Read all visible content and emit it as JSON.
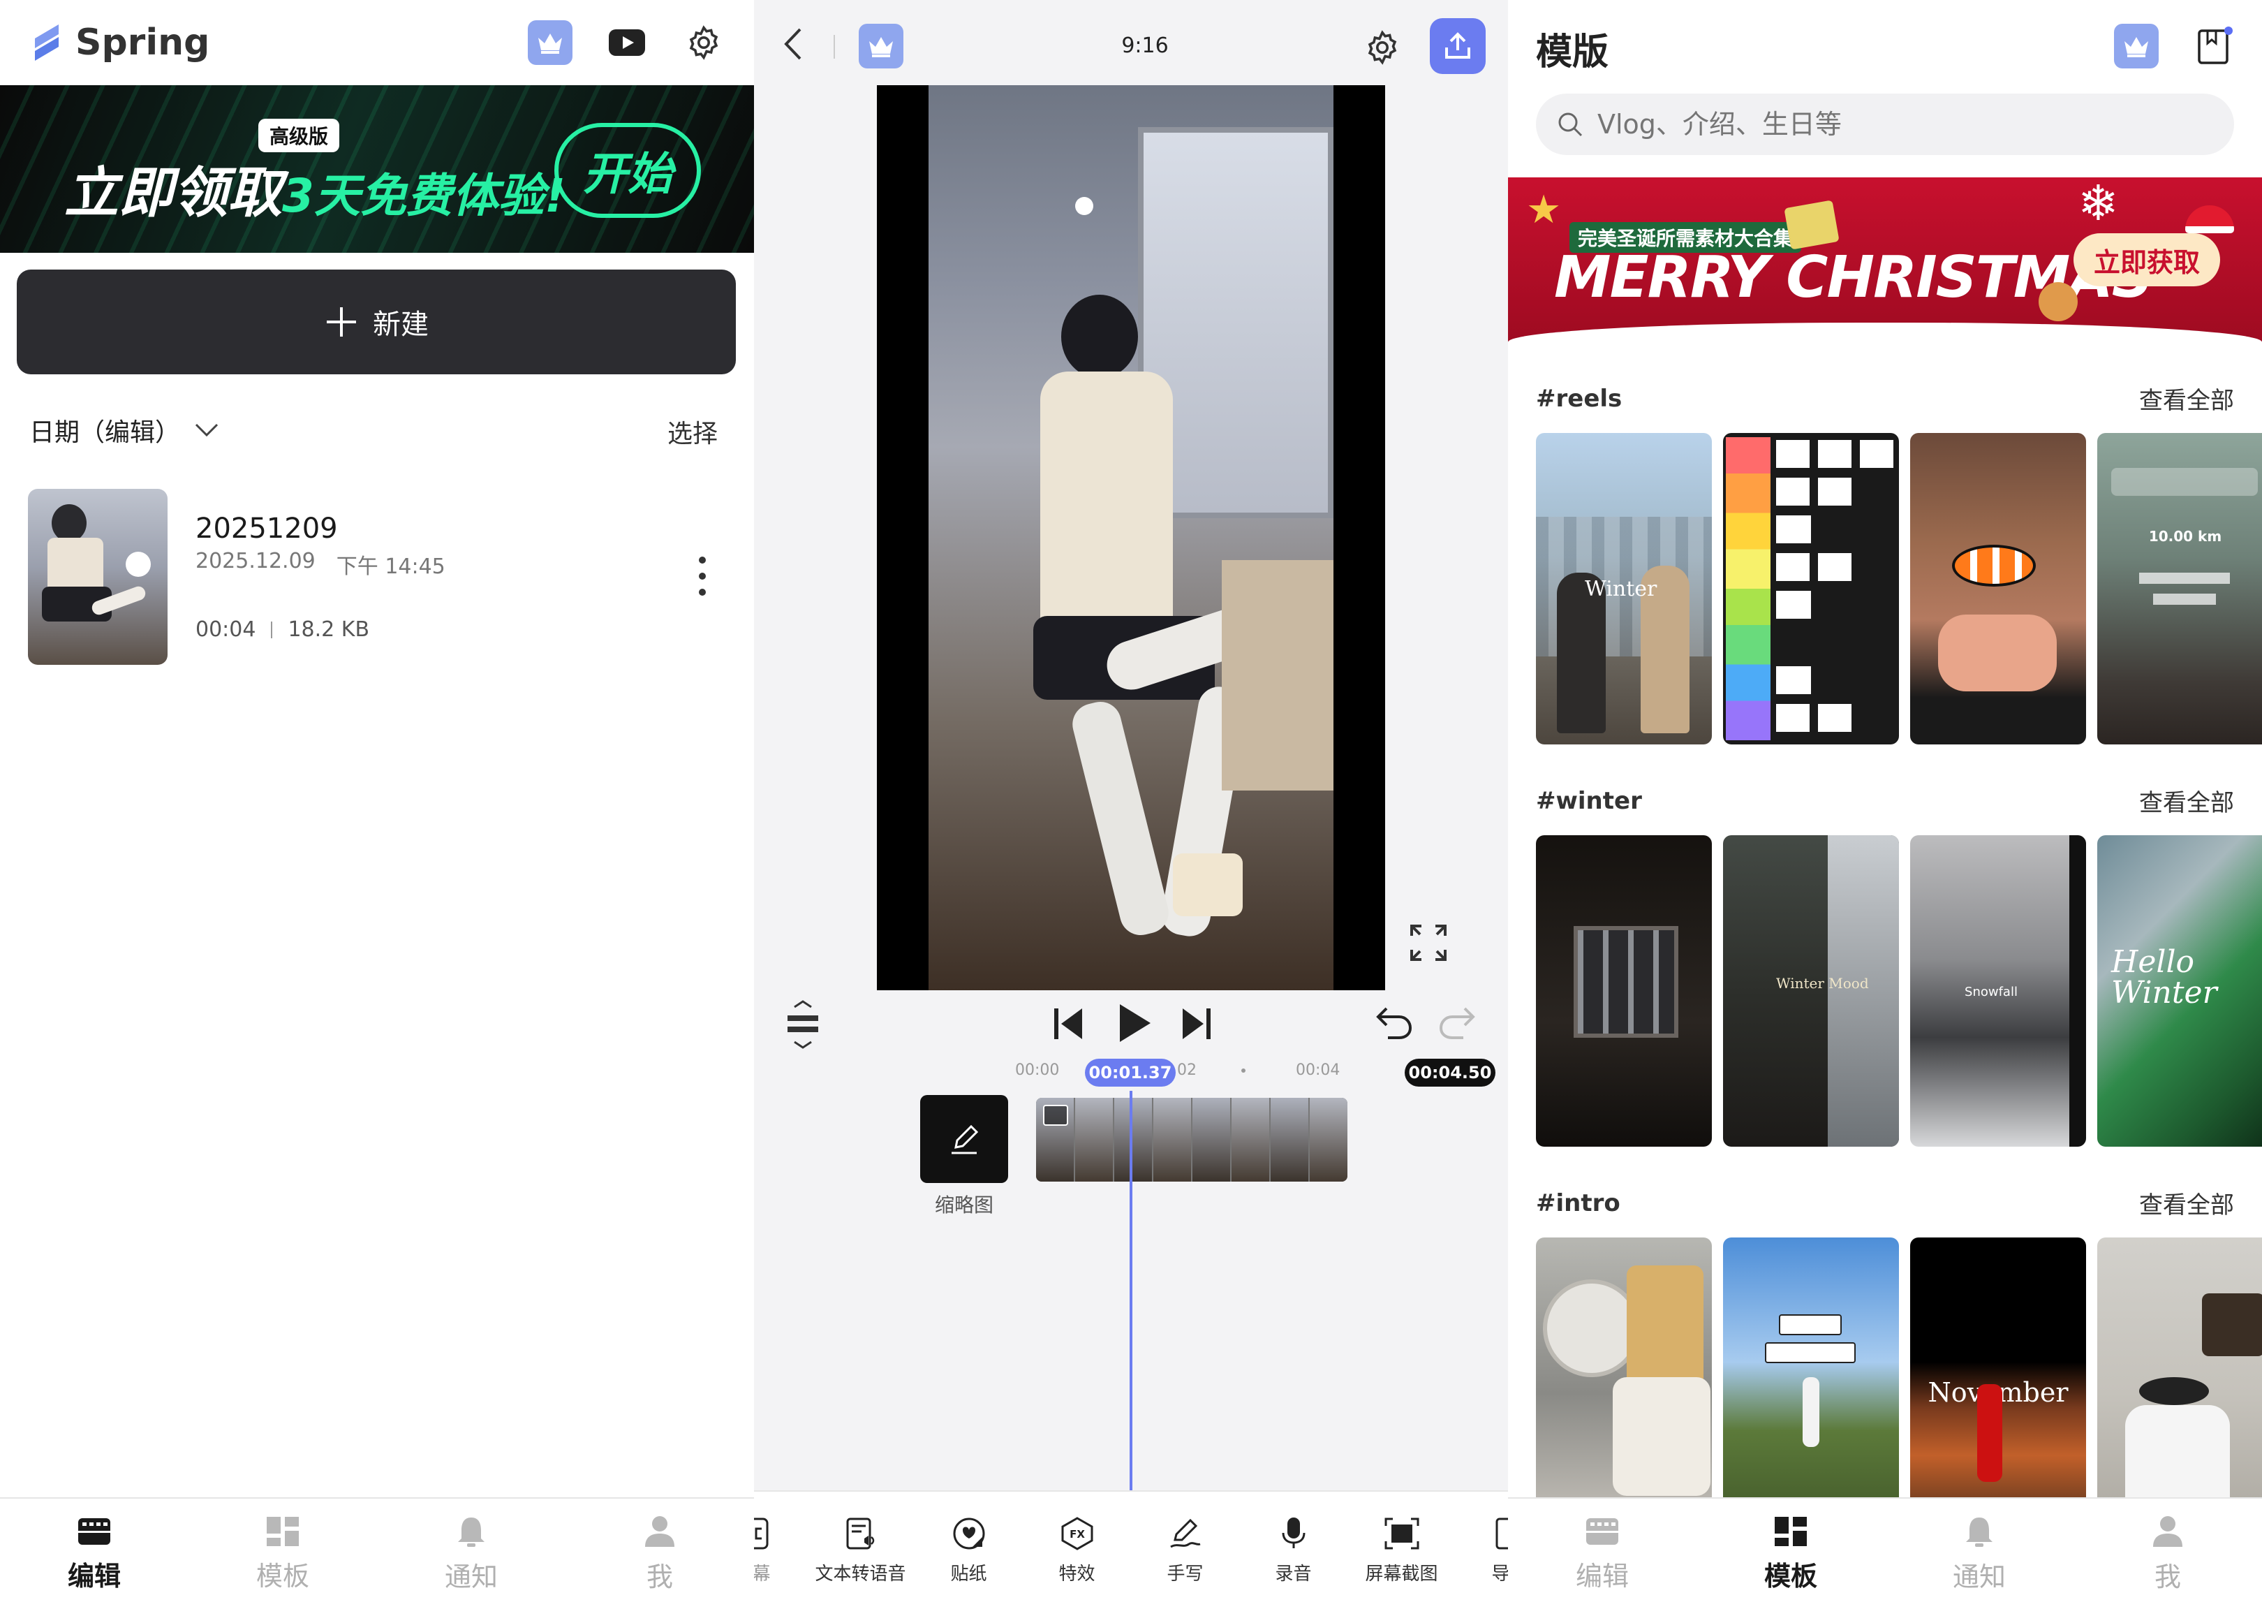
{
  "left": {
    "logo": "Spring",
    "promo": {
      "badge": "高级版",
      "text_white": "立即领取",
      "text_green": "3天免费体验!",
      "button": "开始"
    },
    "new_button": "新建",
    "sort_label": "日期（编辑）",
    "select_label": "选择",
    "project": {
      "name": "20251209",
      "date": "2025.12.09",
      "time": "下午 14:45",
      "duration": "00:04",
      "size": "18.2 KB"
    },
    "nav": [
      {
        "label": "编辑",
        "icon": "film-icon",
        "active": true
      },
      {
        "label": "模板",
        "icon": "grid-icon",
        "active": false
      },
      {
        "label": "通知",
        "icon": "bell-icon",
        "active": false
      },
      {
        "label": "我",
        "icon": "person-icon",
        "active": false
      }
    ]
  },
  "editor": {
    "aspect": "9:16",
    "ruler": {
      "t0": "00:00",
      "t2": "02",
      "t4": "00:04"
    },
    "current_time": "00:01.37",
    "total_time": "00:04.50",
    "cover_label": "缩略图",
    "tools": [
      {
        "label": "字幕",
        "icon": "caption-icon"
      },
      {
        "label": "文本转语音",
        "icon": "text-to-speech-icon"
      },
      {
        "label": "贴纸",
        "icon": "sticker-icon"
      },
      {
        "label": "特效",
        "icon": "fx-icon"
      },
      {
        "label": "手写",
        "icon": "handwriting-icon"
      },
      {
        "label": "录音",
        "icon": "microphone-icon"
      },
      {
        "label": "屏幕截图",
        "icon": "screenshot-icon"
      },
      {
        "label": "导入",
        "icon": "import-icon"
      }
    ],
    "colors": {
      "accent": "#6b7cf0"
    }
  },
  "templates": {
    "title": "模版",
    "search_placeholder": "Vlog、介绍、生日等",
    "banner": {
      "subtitle": "完美圣诞所需素材大合集",
      "title": "MERRY CHRISTMAS",
      "button": "立即获取"
    },
    "sections": [
      {
        "tag": "#reels",
        "view_all": "查看全部",
        "captions": [
          "Winter",
          "",
          "",
          "10.00 km"
        ]
      },
      {
        "tag": "#winter",
        "view_all": "查看全部",
        "captions": [
          "",
          "Winter Mood",
          "Snowfall",
          "Hello Winter"
        ]
      },
      {
        "tag": "#intro",
        "view_all": "查看全部",
        "captions": [
          "",
          "",
          "November",
          ""
        ]
      }
    ],
    "nav": [
      {
        "label": "编辑",
        "icon": "film-icon",
        "active": false
      },
      {
        "label": "模板",
        "icon": "grid-icon",
        "active": true
      },
      {
        "label": "通知",
        "icon": "bell-icon",
        "active": false
      },
      {
        "label": "我",
        "icon": "person-icon",
        "active": false
      }
    ]
  }
}
